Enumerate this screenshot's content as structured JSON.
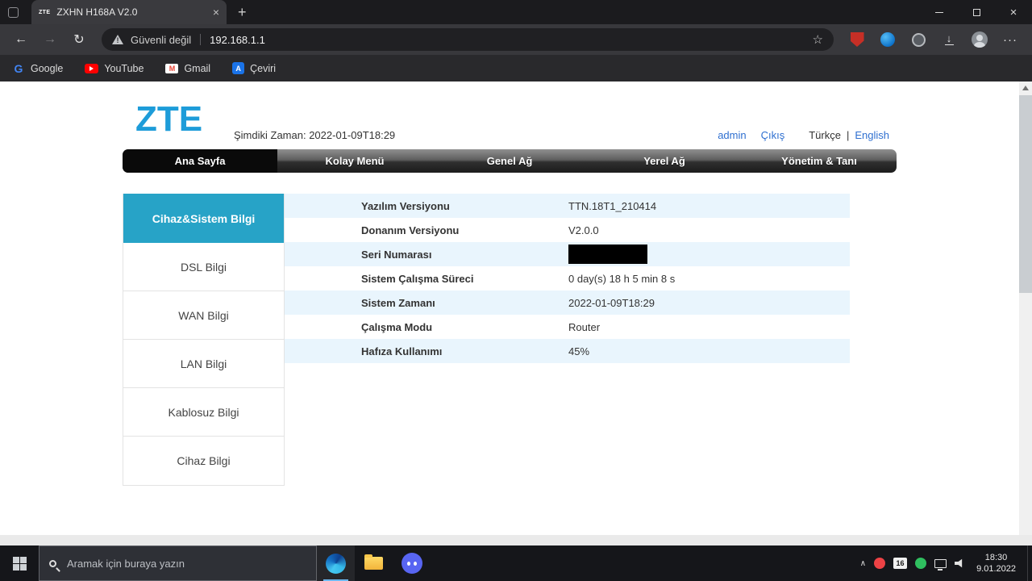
{
  "browser": {
    "tab": {
      "favicon": "ZTE",
      "title": "ZXHN H168A V2.0"
    },
    "icons": {
      "back": "←",
      "forward": "→",
      "reload": "↻",
      "new_tab": "+",
      "tab_close": "×",
      "window_close": "×",
      "star": "☆",
      "menu": "···",
      "download": "↓",
      "warning": "!",
      "chevron_up": "∧"
    },
    "address": {
      "security_label": "Güvenli değil",
      "url": "192.168.1.1"
    },
    "bookmarks": [
      {
        "label": "Google"
      },
      {
        "label": "YouTube"
      },
      {
        "label": "Gmail"
      },
      {
        "label": "Çeviri"
      }
    ]
  },
  "page": {
    "logo": "ZTE",
    "current_time": "Şimdiki Zaman: 2022-01-09T18:29",
    "links": {
      "admin": "admin",
      "logout": "Çıkış",
      "lang_current": "Türkçe",
      "lang_separator": "|",
      "lang_english": "English"
    },
    "nav": [
      {
        "label": "Ana Sayfa",
        "active": true
      },
      {
        "label": "Kolay Menü"
      },
      {
        "label": "Genel Ağ"
      },
      {
        "label": "Yerel Ağ"
      },
      {
        "label": "Yönetim & Tanı"
      }
    ],
    "sidebar": [
      {
        "label": "Cihaz&Sistem Bilgi",
        "active": true
      },
      {
        "label": "DSL Bilgi"
      },
      {
        "label": "WAN Bilgi"
      },
      {
        "label": "LAN Bilgi"
      },
      {
        "label": "Kablosuz Bilgi"
      },
      {
        "label": "Cihaz Bilgi"
      }
    ],
    "info_rows": [
      {
        "label": "Yazılım Versiyonu",
        "value": "TTN.18T1_210414"
      },
      {
        "label": "Donanım Versiyonu",
        "value": "V2.0.0"
      },
      {
        "label": "Seri Numarası",
        "value": "",
        "redacted": true
      },
      {
        "label": "Sistem Çalışma Süreci",
        "value": "0 day(s) 18 h 5 min 8 s"
      },
      {
        "label": "Sistem Zamanı",
        "value": "2022-01-09T18:29"
      },
      {
        "label": "Çalışma Modu",
        "value": "Router"
      },
      {
        "label": "Hafıza Kullanımı",
        "value": "45%"
      }
    ]
  },
  "taskbar": {
    "search_placeholder": "Aramak için buraya yazın",
    "tray_badge": "16",
    "time": "18:30",
    "date": "9.01.2022"
  },
  "colors": {
    "accent_teal": "#27a3c7",
    "link_blue": "#2e6fd0",
    "row_alt": "#e9f5fd",
    "logo_blue": "#1d9cd9"
  }
}
